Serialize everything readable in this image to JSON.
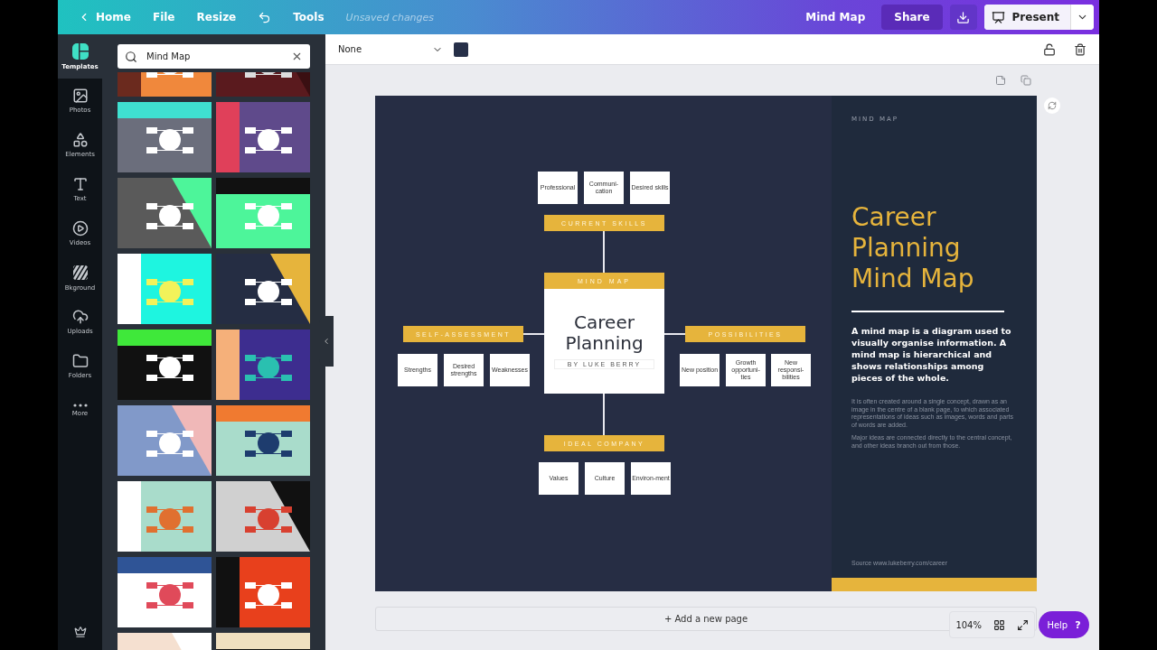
{
  "topbar": {
    "back": "Home",
    "menus": [
      {
        "label": "File"
      },
      {
        "label": "Resize"
      }
    ],
    "tools": "Tools",
    "status": "Unsaved changes",
    "doc_title": "Mind Map",
    "share": "Share",
    "present": "Present"
  },
  "sidebar": {
    "items": [
      {
        "label": "Templates",
        "selected": true
      },
      {
        "label": "Photos",
        "selected": false
      },
      {
        "label": "Elements",
        "selected": false
      },
      {
        "label": "Text",
        "selected": false
      },
      {
        "label": "Videos",
        "selected": false
      },
      {
        "label": "Bkground",
        "selected": false
      },
      {
        "label": "Uploads",
        "selected": false
      },
      {
        "label": "Folders",
        "selected": false
      },
      {
        "label": "More",
        "selected": false
      }
    ]
  },
  "search": {
    "value": "Mind Map"
  },
  "toolbar": {
    "font": "None",
    "color": "#262f48"
  },
  "design": {
    "map": {
      "center": {
        "header": "MIND MAP",
        "title": "Career Planning",
        "byline": "BY LUKE BERRY"
      },
      "branches": [
        {
          "label": "CURRENT SKILLS",
          "nodes": [
            "Professional",
            "Communi-cation",
            "Desired skills"
          ]
        },
        {
          "label": "SELF-ASSESSMENT",
          "nodes": [
            "Strengths",
            "Desired strengths",
            "Weaknesses"
          ]
        },
        {
          "label": "POSSIBILITIES",
          "nodes": [
            "New position",
            "Growth opportuni-ties",
            "New responsi-bilities"
          ]
        },
        {
          "label": "IDEAL COMPANY",
          "nodes": [
            "Values",
            "Culture",
            "Environ-ment"
          ]
        }
      ]
    },
    "panel": {
      "kicker": "MIND MAP",
      "title": "Career Planning Mind Map",
      "lead": "A mind map is a diagram used to visually organise information. A mind map is hierarchical and shows relationships among pieces of the whole.",
      "paragraphs": [
        "It is often created around a single concept, drawn as an image in the centre of a blank page, to which associated representations of ideas such as images, words and parts of words are added.",
        "Major ideas are connected directly to the central concept, and other ideas branch out from those."
      ],
      "source": "Source www.lukeberry.com/career"
    }
  },
  "add_page": "+ Add a new page",
  "zoom": "104%",
  "help": {
    "label": "Help",
    "mark": "?"
  }
}
